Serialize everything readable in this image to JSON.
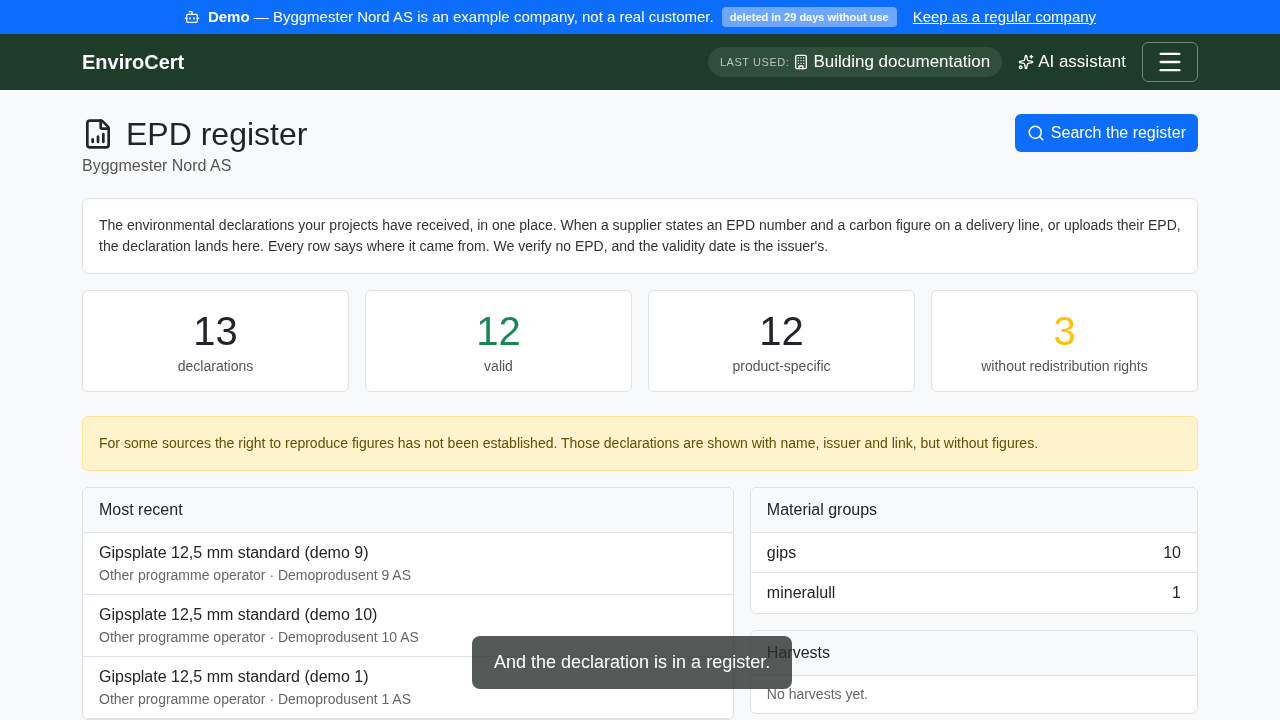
{
  "demo_banner": {
    "label": "Demo",
    "message": "— Byggmester Nord AS is an example company, not a real customer.",
    "badge": "deleted in 29 days without use",
    "link": "Keep as a regular company"
  },
  "navbar": {
    "brand": "EnviroCert",
    "last_used_label": "LAST USED:",
    "last_used": "Building documentation",
    "assistant": "AI assistant"
  },
  "header": {
    "title": "EPD register",
    "subtitle": "Byggmester Nord AS",
    "search_button": "Search the register"
  },
  "intro": "The environmental declarations your projects have received, in one place. When a supplier states an EPD number and a carbon figure on a delivery line, or uploads their EPD, the declaration lands here. Every row says where it came from. We verify no EPD, and the validity date is the issuer's.",
  "stats": [
    {
      "value": "13",
      "label": "declarations",
      "color": "#212529"
    },
    {
      "value": "12",
      "label": "valid",
      "color": "#198754"
    },
    {
      "value": "12",
      "label": "product-specific",
      "color": "#212529"
    },
    {
      "value": "3",
      "label": "without redistribution rights",
      "color": "#ffc107"
    }
  ],
  "warning": "For some sources the right to reproduce figures has not been established. Those declarations are shown with name, issuer and link, but without figures.",
  "recent": {
    "title": "Most recent",
    "items": [
      {
        "name": "Gipsplate 12,5 mm standard (demo 9)",
        "meta": "Other programme operator · Demoprodusent 9 AS"
      },
      {
        "name": "Gipsplate 12,5 mm standard (demo 10)",
        "meta": "Other programme operator · Demoprodusent 10 AS"
      },
      {
        "name": "Gipsplate 12,5 mm standard (demo 1)",
        "meta": "Other programme operator · Demoprodusent 1 AS"
      }
    ]
  },
  "material_groups": {
    "title": "Material groups",
    "items": [
      {
        "name": "gips",
        "count": "10"
      },
      {
        "name": "mineralull",
        "count": "1"
      }
    ]
  },
  "harvests": {
    "title": "Harvests",
    "empty": "No harvests yet."
  },
  "toast": "And the declaration is in a register."
}
